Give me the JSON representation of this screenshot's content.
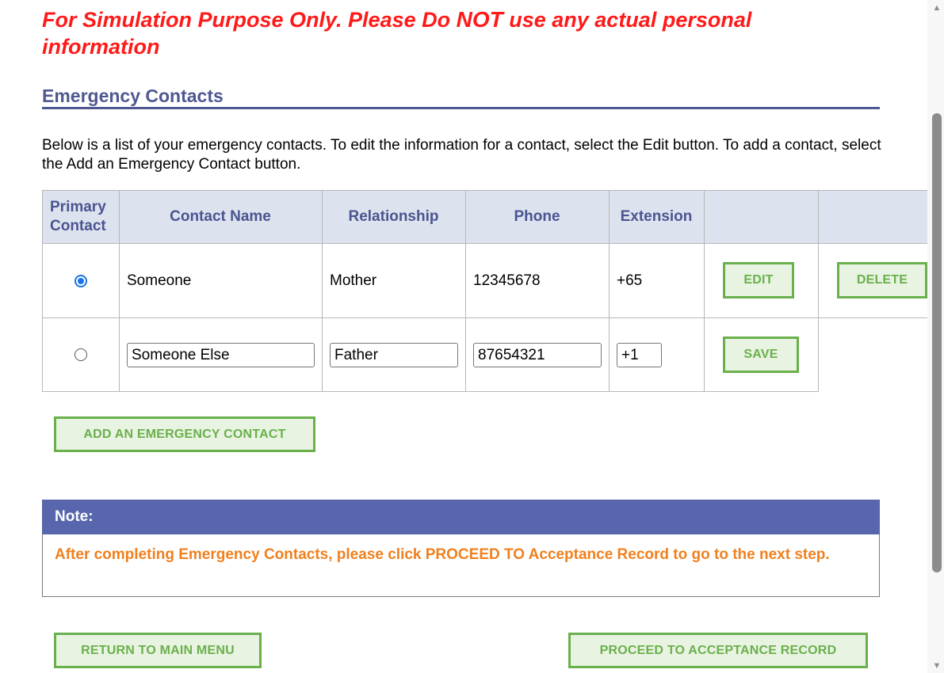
{
  "warning": {
    "part1": "For Simulation Purpose Only. Please Do ",
    "emphasis": "NOT",
    "part2": " use any actual personal information"
  },
  "section": {
    "title": "Emergency Contacts",
    "intro": "Below is a list of your emergency contacts. To edit the information for a contact, select the Edit button. To add a contact, select the Add an Emergency Contact button."
  },
  "table": {
    "headers": {
      "primary": "Primary Contact",
      "name": "Contact Name",
      "relationship": "Relationship",
      "phone": "Phone",
      "extension": "Extension"
    },
    "rows": [
      {
        "primary": true,
        "name": "Someone",
        "relationship": "Mother",
        "phone": "12345678",
        "extension": "+65",
        "edit_label": "EDIT",
        "delete_label": "DELETE"
      },
      {
        "primary": false,
        "name": "Someone Else",
        "relationship": "Father",
        "phone": "87654321",
        "extension": "+1",
        "save_label": "SAVE"
      }
    ]
  },
  "buttons": {
    "add_contact": "ADD AN EMERGENCY CONTACT",
    "return_menu": "RETURN TO MAIN MENU",
    "proceed": "PROCEED TO ACCEPTANCE RECORD"
  },
  "note": {
    "heading": "Note:",
    "body": "After completing Emergency Contacts, please click PROCEED TO Acceptance Record to go to the next step."
  },
  "colors": {
    "warning": "#ff1a1a",
    "heading": "#4f5891",
    "button_border": "#6ab04c",
    "button_bg": "#e8f3e1",
    "note_header": "#5866ad",
    "note_text": "#f0801e"
  }
}
